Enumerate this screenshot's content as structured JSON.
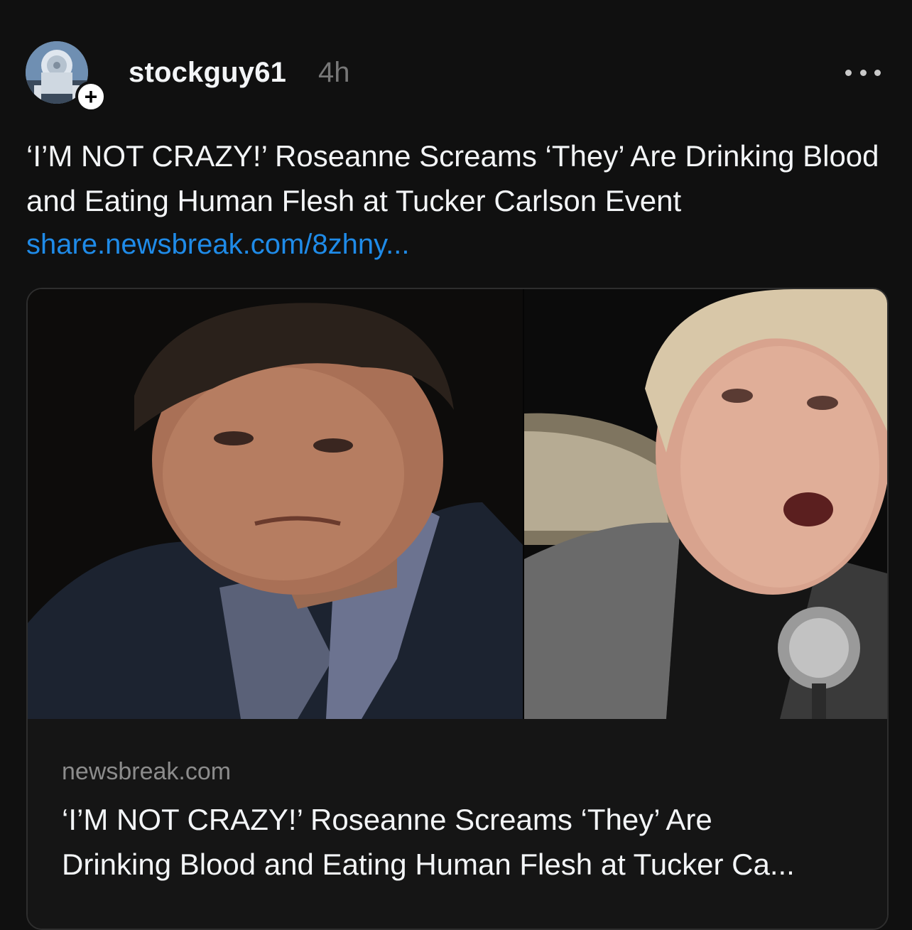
{
  "post": {
    "username": "stockguy61",
    "timestamp": "4h",
    "follow_icon": "plus-icon",
    "more_icon": "more-horizontal-icon",
    "caption": "‘I’M NOT CRAZY!’ Roseanne Screams ‘They’ Are Drinking Blood and Eating Human Flesh at Tucker Carlson Event",
    "link_text": "share.newsbreak.com/8zhny..."
  },
  "link_card": {
    "domain": "newsbreak.com",
    "title": "‘I’M NOT CRAZY!’ Roseanne Screams ‘They’ Are\nDrinking Blood and Eating Human Flesh at Tucker Ca..."
  },
  "colors": {
    "background": "#101010",
    "text": "#f3f5f7",
    "muted": "#777777",
    "link": "#1f8be8",
    "card_border": "#2e2e2e"
  }
}
